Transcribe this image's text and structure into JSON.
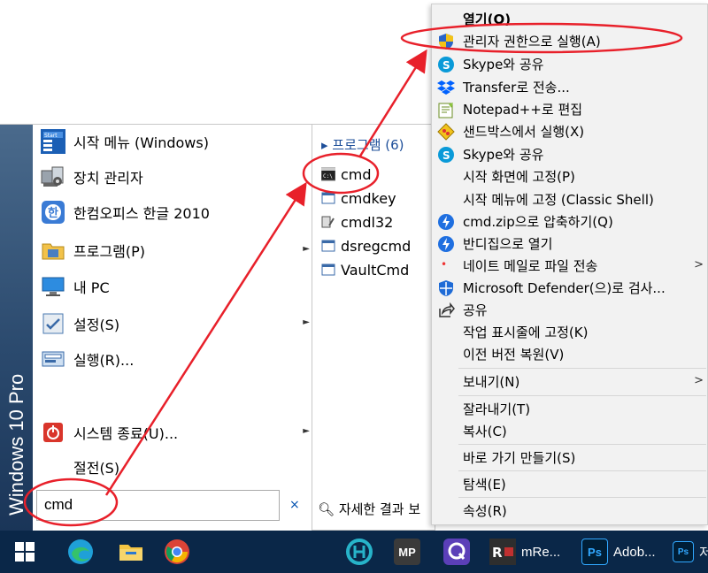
{
  "start_menu": {
    "banner": "Windows 10 Pro",
    "items": [
      {
        "label": "시작 메뉴 (Windows)"
      },
      {
        "label": "장치 관리자"
      },
      {
        "label": "한컴오피스 한글 2010"
      },
      {
        "label": "프로그램(P)"
      },
      {
        "label": "내 PC"
      },
      {
        "label": "설정(S)"
      },
      {
        "label": "실행(R)..."
      },
      {
        "label": "시스템 종료(U)..."
      },
      {
        "label": "절전(S)"
      }
    ],
    "search_value": "cmd",
    "search_clear": "×"
  },
  "programs": {
    "header": "▸ 프로그램 (6)",
    "items": [
      "cmd",
      "cmdkey",
      "cmdl32",
      "dsregcmd",
      "VaultCmd"
    ],
    "more": "자세한 결과 보"
  },
  "context_menu": {
    "items": [
      "열기(O)",
      "관리자 권한으로 실행(A)",
      "Skype와 공유",
      "Transfer로 전송...",
      "Notepad++로 편집",
      "샌드박스에서 실행(X)",
      "Skype와 공유",
      "시작 화면에 고정(P)",
      "시작 메뉴에 고정 (Classic Shell)",
      "cmd.zip으로 압축하기(Q)",
      "반디집으로 열기",
      "네이트 메일로 파일 전송",
      "Microsoft Defender(으)로 검사...",
      "공유",
      "작업 표시줄에 고정(K)",
      "이전 버전 복원(V)",
      "보내기(N)",
      "잘라내기(T)",
      "복사(C)",
      "바로 가기 만들기(S)",
      "탐색(E)",
      "속성(R)"
    ]
  },
  "taskbar": {
    "items": [
      "mRe...",
      "Adob...",
      "Ps",
      "MP",
      "Ps"
    ],
    "last_label": "저"
  },
  "colors": {
    "annotation_red": "#e8202a",
    "taskbar": "#0a2748",
    "accent_blue": "#1e4f9a"
  }
}
